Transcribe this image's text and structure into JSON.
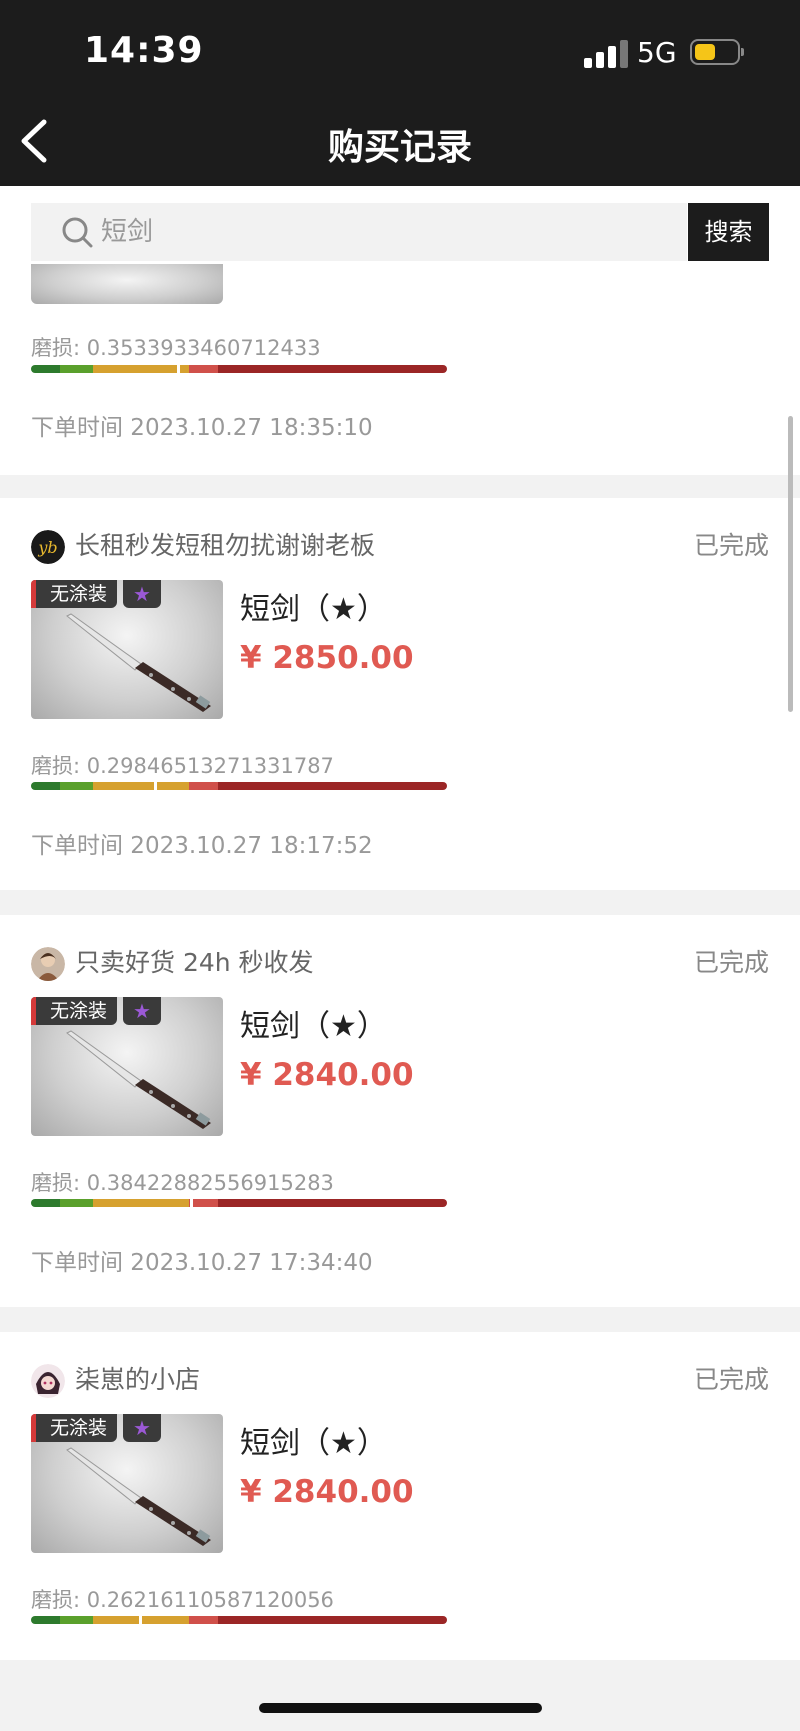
{
  "status_bar": {
    "time": "14:39",
    "network": "5G"
  },
  "header": {
    "title": "购买记录"
  },
  "search": {
    "value": "短剑",
    "button": "搜索"
  },
  "partial_record": {
    "wear_label": "磨损: 0.3533933460712433",
    "wear_value": 0.3533933460712433,
    "order_time": "下单时间 2023.10.27 18:35:10"
  },
  "records": [
    {
      "seller": "长租秒发短租勿扰谢谢老板",
      "status": "已完成",
      "tag": "无涂装",
      "star": "★",
      "product_name": "短剑（★）",
      "price": "¥ 2850.00",
      "wear_label": "磨损: 0.29846513271331787",
      "wear_value": 0.29846513271331787,
      "order_time": "下单时间 2023.10.27 18:17:52"
    },
    {
      "seller": "只卖好货 24h 秒收发",
      "status": "已完成",
      "tag": "无涂装",
      "star": "★",
      "product_name": "短剑（★）",
      "price": "¥ 2840.00",
      "wear_label": "磨损: 0.38422882556915283",
      "wear_value": 0.38422882556915283,
      "order_time": "下单时间 2023.10.27 17:34:40"
    },
    {
      "seller": "柒崽的小店",
      "status": "已完成",
      "tag": "无涂装",
      "star": "★",
      "product_name": "短剑（★）",
      "price": "¥ 2840.00",
      "wear_label": "磨损: 0.26216110587120056",
      "wear_value": 0.26216110587120056
    }
  ],
  "colors": {
    "header_bg": "#1c1c1c",
    "price": "#e05a52",
    "wear_segments": [
      "#2d7a2d",
      "#5aa02c",
      "#d6a12f",
      "#d0504a",
      "#9b2626"
    ]
  }
}
